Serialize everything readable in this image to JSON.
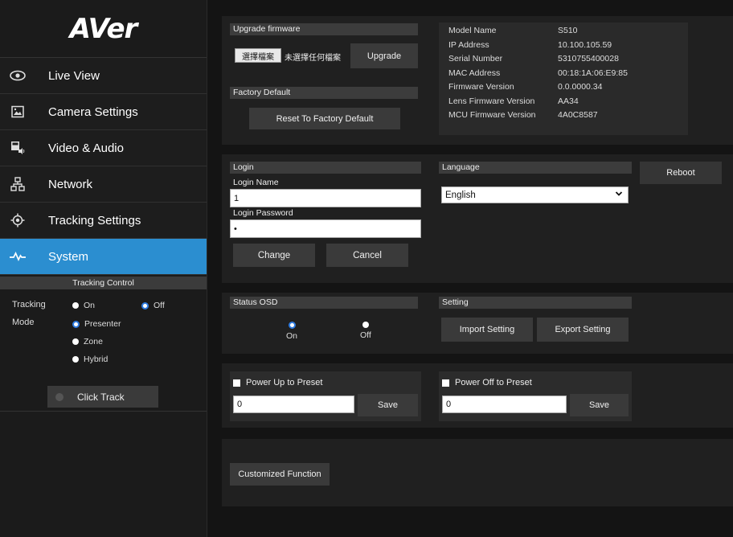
{
  "brand": "AVer",
  "nav": [
    {
      "label": "Live View",
      "icon": "eye-icon"
    },
    {
      "label": "Camera Settings",
      "icon": "image-icon"
    },
    {
      "label": "Video & Audio",
      "icon": "video-audio-icon"
    },
    {
      "label": "Network",
      "icon": "network-icon"
    },
    {
      "label": "Tracking Settings",
      "icon": "target-icon"
    },
    {
      "label": "System",
      "icon": "pulse-icon"
    }
  ],
  "tracking_control": {
    "title": "Tracking Control",
    "tracking_label": "Tracking",
    "tracking_on": "On",
    "tracking_off": "Off",
    "tracking_value": "Off",
    "mode_label": "Mode",
    "mode_presenter": "Presenter",
    "mode_zone": "Zone",
    "mode_hybrid": "Hybrid",
    "mode_value": "Presenter",
    "click_track": "Click Track"
  },
  "upgrade": {
    "title": "Upgrade firmware",
    "choose_file": "選擇檔案",
    "no_file": "未選擇任何檔案",
    "upgrade_button": "Upgrade"
  },
  "factory": {
    "title": "Factory Default",
    "reset_button": "Reset To Factory Default"
  },
  "info": {
    "rows": [
      {
        "key": "Model Name",
        "value": "S510"
      },
      {
        "key": "IP Address",
        "value": "10.100.105.59"
      },
      {
        "key": "Serial Number",
        "value": "5310755400028"
      },
      {
        "key": "MAC Address",
        "value": "00:18:1A:06:E9:85"
      },
      {
        "key": "Firmware Version",
        "value": "0.0.0000.34"
      },
      {
        "key": "Lens Firmware Version",
        "value": "AA34"
      },
      {
        "key": "MCU Firmware Version",
        "value": "4A0C8587"
      }
    ]
  },
  "login": {
    "title": "Login",
    "name_label": "Login Name",
    "name_value": "1",
    "password_label": "Login Password",
    "password_value": "•",
    "change_button": "Change",
    "cancel_button": "Cancel"
  },
  "language": {
    "title": "Language",
    "selected": "English"
  },
  "reboot_button": "Reboot",
  "status_osd": {
    "title": "Status OSD",
    "on": "On",
    "off": "Off",
    "value": "On"
  },
  "setting": {
    "title": "Setting",
    "import_button": "Import Setting",
    "export_button": "Export Setting"
  },
  "power_up": {
    "label": "Power Up to Preset",
    "value": "0",
    "save": "Save"
  },
  "power_off": {
    "label": "Power Off to Preset",
    "value": "0",
    "save": "Save"
  },
  "customized_button": "Customized Function",
  "colors": {
    "accent": "#2b8ed0",
    "background": "#141414",
    "panel": "#202020"
  }
}
